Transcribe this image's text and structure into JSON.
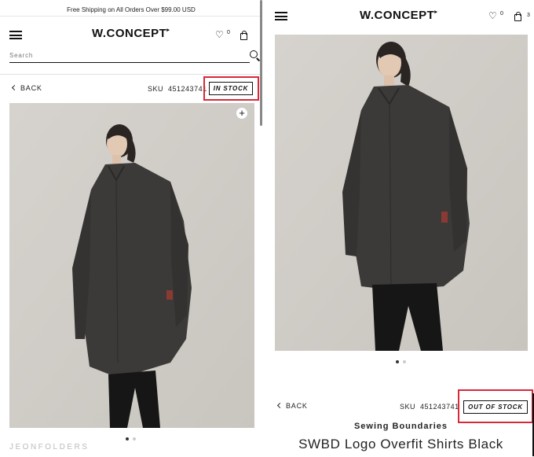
{
  "left_screen": {
    "promo_text": "Free Shipping on All Orders Over $99.00 USD",
    "logo": "W.CONCEPT",
    "wishlist_count": "0",
    "search": {
      "placeholder": "Search"
    },
    "back_label": "BACK",
    "sku_label": "SKU",
    "sku_value": "451243741",
    "stock_status": "IN STOCK",
    "carousel": {
      "total": 2,
      "active": 1
    },
    "watermark": "JEONFOLDERS"
  },
  "right_screen": {
    "logo": "W.CONCEPT",
    "wishlist_count": "0",
    "cart_count": "3",
    "back_label": "BACK",
    "sku_label": "SKU",
    "sku_value": "451243741",
    "stock_status": "OUT OF STOCK",
    "carousel": {
      "total": 2,
      "active": 1
    },
    "brand": "Sewing Boundaries",
    "product_title": "SWBD Logo Overfit Shirts Black"
  },
  "colors": {
    "highlight": "#d8283a",
    "photo_background": "#d3d0cb",
    "shirt": "#3b3a38",
    "pants": "#161616"
  },
  "icons": [
    "menu-icon",
    "heart-icon",
    "bag-icon",
    "search-icon",
    "chevron-left-icon",
    "plus-icon"
  ]
}
